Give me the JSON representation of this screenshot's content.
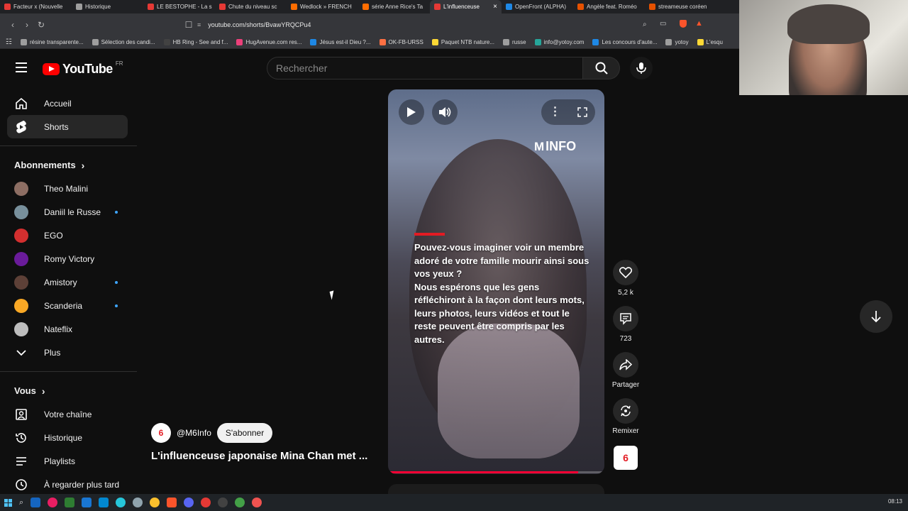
{
  "browser": {
    "tabs": [
      {
        "label": "Facteur x (Nouvelle",
        "color": "#e53935"
      },
      {
        "label": "Historique",
        "color": "#9e9e9e"
      },
      {
        "label": "LE BESTOPHE - La s",
        "color": "#e53935"
      },
      {
        "label": "Chute du niveau sc",
        "color": "#e53935"
      },
      {
        "label": "Wedlock » FRENCH",
        "color": "#ff6d00"
      },
      {
        "label": "série Anne Rice's Ta",
        "color": "#ff6d00"
      },
      {
        "label": "L'influenceuse",
        "color": "#e53935"
      },
      {
        "label": "OpenFront (ALPHA)",
        "color": "#1e88e5"
      },
      {
        "label": "Angèle feat. Roméo",
        "color": "#e65100"
      },
      {
        "label": "streameuse coréen",
        "color": "#e65100"
      }
    ],
    "active_tab_index": 6,
    "url": "youtube.com/shorts/BvawYRQCPu4",
    "bookmarks": [
      "résine transparente...",
      "Sélection des candi...",
      "HB Ring - See and f...",
      "HugAvenue.com res...",
      "Jésus est-il Dieu ?...",
      "OK-FB-URSS",
      "Paquet NTB nature...",
      "russe",
      "info@yotoy.com",
      "Les concours d'aute...",
      "yotoy",
      "L'esqu"
    ]
  },
  "header": {
    "logo_text": "YouTube",
    "country_code": "FR",
    "search_placeholder": "Rechercher"
  },
  "sidebar": {
    "main_items": [
      {
        "label": "Accueil",
        "icon": "home-icon"
      },
      {
        "label": "Shorts",
        "icon": "shorts-icon",
        "active": true
      }
    ],
    "subscriptions_heading": "Abonnements",
    "subscriptions": [
      {
        "label": "Theo Malini",
        "color": "#8d6e63",
        "new": false
      },
      {
        "label": "Daniil le Russe",
        "color": "#78909c",
        "new": true
      },
      {
        "label": "EGO",
        "color": "#d32f2f",
        "new": false
      },
      {
        "label": "Romy Victory",
        "color": "#6a1b9a",
        "new": false
      },
      {
        "label": "Amistory",
        "color": "#5d4037",
        "new": true
      },
      {
        "label": "Scanderia",
        "color": "#f9a825",
        "new": true
      },
      {
        "label": "Nateflix",
        "color": "#bdbdbd",
        "new": false
      }
    ],
    "more_label": "Plus",
    "you_heading": "Vous",
    "you_items": [
      {
        "label": "Votre chaîne",
        "icon": "channel-icon"
      },
      {
        "label": "Historique",
        "icon": "history-icon"
      },
      {
        "label": "Playlists",
        "icon": "playlist-icon"
      },
      {
        "label": "À regarder plus tard",
        "icon": "clock-icon"
      }
    ]
  },
  "short": {
    "brand": "INFO",
    "caption": "Pouvez-vous imaginer voir un membre adoré de votre famille mourir ainsi sous vos yeux ?\nNous espérons que les gens réfléchiront à la façon dont leurs mots, leurs photos, leurs vidéos et tout le reste peuvent être compris par les autres.",
    "progress": 0.88,
    "channel_handle": "@M6Info",
    "subscribe_label": "S'abonner",
    "title": "L'influenceuse japonaise Mina Chan met ...",
    "likes": "5,2 k",
    "comments": "723",
    "share_label": "Partager",
    "remix_label": "Remixer",
    "accent_color": "#e31b23"
  },
  "taskbar": {
    "clock": "08:13"
  }
}
